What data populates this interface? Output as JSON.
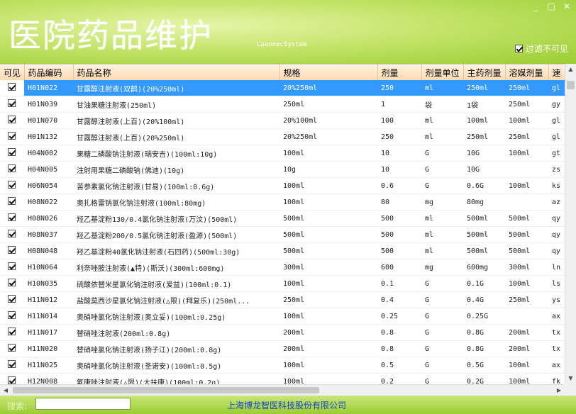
{
  "window": {
    "title": "医院药品维护",
    "subtitle": "LaennecSystem",
    "buttons": [
      "_",
      "□",
      "✕"
    ]
  },
  "filter": {
    "label": "过滤不可见",
    "checked": true
  },
  "grid": {
    "columns": [
      "可见",
      "药品编码",
      "药品名称",
      "规格",
      "剂量",
      "剂量单位",
      "主药剂量",
      "溶媒剂量",
      "速"
    ],
    "selected_index": 0,
    "rows": [
      {
        "visible": true,
        "code": "H01N022",
        "name": "甘露醇注射液(双鹤)(20%250ml)",
        "spec": "20%250ml",
        "dose": "250",
        "unit": "ml",
        "main": "250ml",
        "solvent": "250ml",
        "speed": "gl"
      },
      {
        "visible": true,
        "code": "H01N039",
        "name": "甘油果糖注射液(250ml)",
        "spec": "250ml",
        "dose": "1",
        "unit": "袋",
        "main": "1袋",
        "solvent": "250ml",
        "speed": "gy"
      },
      {
        "visible": true,
        "code": "H01N070",
        "name": "甘露醇注射液(上百)(20%100ml)",
        "spec": "20%100ml",
        "dose": "100",
        "unit": "ml",
        "main": "100ml",
        "solvent": "100ml",
        "speed": "gl"
      },
      {
        "visible": true,
        "code": "H01N132",
        "name": "甘露醇注射液(上百)(20%250ml)",
        "spec": "20%250ml",
        "dose": "250",
        "unit": "ml",
        "main": "250ml",
        "solvent": "250ml",
        "speed": "gl"
      },
      {
        "visible": true,
        "code": "H04N002",
        "name": "果糖二磷酸钠注射液(瑞安吉)(100ml:10g)",
        "spec": "100ml",
        "dose": "10",
        "unit": "G",
        "main": "10G",
        "solvent": "100ml",
        "speed": "gt"
      },
      {
        "visible": true,
        "code": "H04N005",
        "name": "注射用果糖二磷酸钠(佛迪)(10g)",
        "spec": "10g",
        "dose": "10",
        "unit": "G",
        "main": "10G",
        "solvent": "",
        "speed": "zs"
      },
      {
        "visible": true,
        "code": "H06N054",
        "name": "苦参素氯化钠注射液(甘易)(100ml:0.6g)",
        "spec": "100ml",
        "dose": "0.6",
        "unit": "G",
        "main": "0.6G",
        "solvent": "100ml",
        "speed": "ks"
      },
      {
        "visible": true,
        "code": "H08N022",
        "name": "奥扎格雷钠氯化钠注射液(100ml:80mg)",
        "spec": "100ml",
        "dose": "80",
        "unit": "mg",
        "main": "80mg",
        "solvent": "",
        "speed": "az"
      },
      {
        "visible": true,
        "code": "H08N026",
        "name": "羟乙基淀粉130/0.4氯化钠注射液(万汶)(500ml)",
        "spec": "500ml",
        "dose": "500",
        "unit": "ml",
        "main": "500ml",
        "solvent": "500ml",
        "speed": "qy"
      },
      {
        "visible": true,
        "code": "H08N037",
        "name": "羟乙基淀粉200/0.5氯化钠注射液(盈源)(500ml)",
        "spec": "500ml",
        "dose": "500",
        "unit": "ml",
        "main": "500ml",
        "solvent": "500ml",
        "speed": "qy"
      },
      {
        "visible": true,
        "code": "H08N048",
        "name": "羟乙基淀粉40氯化钠注射液(石四药)(500ml:30g)",
        "spec": "500ml",
        "dose": "500",
        "unit": "ml",
        "main": "500ml",
        "solvent": "500ml",
        "speed": "qy"
      },
      {
        "visible": true,
        "code": "H10N064",
        "name": "利奈唑胺注射液(▲特)(斯沃)(300ml:600mg)",
        "spec": "300ml",
        "dose": "600",
        "unit": "mg",
        "main": "600mg",
        "solvent": "300ml",
        "speed": "ln"
      },
      {
        "visible": true,
        "code": "H10N035",
        "name": "硫酸依替米星氯化钠注射液(爱益)(100ml:0.1)",
        "spec": "100ml",
        "dose": "0.1",
        "unit": "G",
        "main": "0.1G",
        "solvent": "100ml",
        "speed": "ls"
      },
      {
        "visible": true,
        "code": "H11N012",
        "name": "盐酸莫西沙星氯化钠注射液(△限)(拜复乐)(250ml...",
        "spec": "250ml",
        "dose": "0.4",
        "unit": "G",
        "main": "0.4G",
        "solvent": "250ml",
        "speed": "ys"
      },
      {
        "visible": true,
        "code": "H11N014",
        "name": "奥硝唑氯化钠注射液(奥立妥)(100ml:0.25g)",
        "spec": "100ml",
        "dose": "0.25",
        "unit": "G",
        "main": "0.25G",
        "solvent": "",
        "speed": "ax"
      },
      {
        "visible": true,
        "code": "H11N017",
        "name": "替硝唑注射液(200ml:0.8g)",
        "spec": "200ml",
        "dose": "0.8",
        "unit": "G",
        "main": "0.8G",
        "solvent": "200ml",
        "speed": "tx"
      },
      {
        "visible": true,
        "code": "H11N020",
        "name": "替硝唑氯化钠注射液(扬子江)(200ml:0.8g)",
        "spec": "200ml",
        "dose": "0.8",
        "unit": "G",
        "main": "0.8G",
        "solvent": "200ml",
        "speed": "tx"
      },
      {
        "visible": true,
        "code": "H11N025",
        "name": "奥硝唑氯化钠注射液(圣诺安)(100ml:0.5g)",
        "spec": "100ml",
        "dose": "0.5",
        "unit": "G",
        "main": "0.5G",
        "solvent": "100ml",
        "speed": "ax"
      },
      {
        "visible": true,
        "code": "H12N008",
        "name": "氟康唑注射液(△限)(大扶康)(100ml:0.2g)",
        "spec": "100ml",
        "dose": "0.2",
        "unit": "G",
        "main": "0.2G",
        "solvent": "100ml",
        "speed": "fk"
      }
    ]
  },
  "statusbar": {
    "search_label": "搜索:",
    "search_value": "",
    "company": "上海博龙智医科技股份有限公司"
  },
  "colors": {
    "header_green": "#9acd32",
    "selection_blue": "#3399ff",
    "company_text": "#1a3fd0"
  }
}
